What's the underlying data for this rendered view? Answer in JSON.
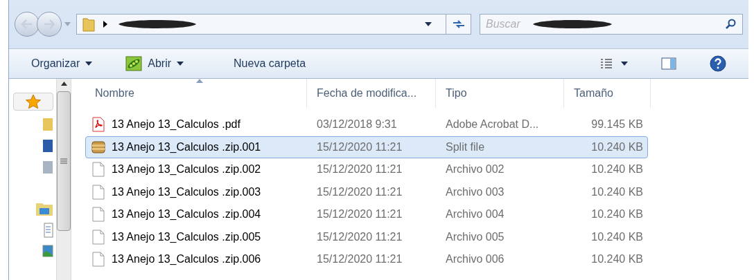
{
  "address_bar": {
    "search_placeholder": "Buscar"
  },
  "toolbar": {
    "items": [
      {
        "label": "Organizar",
        "kind": "menu"
      },
      {
        "label": "Abrir",
        "kind": "open"
      },
      {
        "label": "Nueva carpeta",
        "kind": "plain"
      }
    ]
  },
  "table": {
    "columns": [
      {
        "label": "Nombre",
        "sorted": true
      },
      {
        "label": "Fecha de modifica...",
        "sorted": false
      },
      {
        "label": "Tipo",
        "sorted": false
      },
      {
        "label": "Tamaño",
        "sorted": false
      }
    ],
    "rows": [
      {
        "name": "13 Anejo 13_Calculos .pdf",
        "date": "03/12/2018 9:31",
        "type": "Adobe Acrobat D...",
        "size": "99.145 KB",
        "kind": "pdf",
        "selected": false
      },
      {
        "name": "13 Anejo 13_Calculos .zip.001",
        "date": "15/12/2020 11:21",
        "type": "Split file",
        "size": "10.240 KB",
        "kind": "archive",
        "selected": true
      },
      {
        "name": "13 Anejo 13_Calculos .zip.002",
        "date": "15/12/2020 11:21",
        "type": "Archivo 002",
        "size": "10.240 KB",
        "kind": "file",
        "selected": false
      },
      {
        "name": "13 Anejo 13_Calculos .zip.003",
        "date": "15/12/2020 11:21",
        "type": "Archivo 003",
        "size": "10.240 KB",
        "kind": "file",
        "selected": false
      },
      {
        "name": "13 Anejo 13_Calculos .zip.004",
        "date": "15/12/2020 11:21",
        "type": "Archivo 004",
        "size": "10.240 KB",
        "kind": "file",
        "selected": false
      },
      {
        "name": "13 Anejo 13_Calculos .zip.005",
        "date": "15/12/2020 11:21",
        "type": "Archivo 005",
        "size": "10.240 KB",
        "kind": "file",
        "selected": false
      },
      {
        "name": "13 Anejo 13_Calculos .zip.006",
        "date": "15/12/2020 11:21",
        "type": "Archivo 006",
        "size": "10.240 KB",
        "kind": "file",
        "selected": false
      }
    ]
  }
}
